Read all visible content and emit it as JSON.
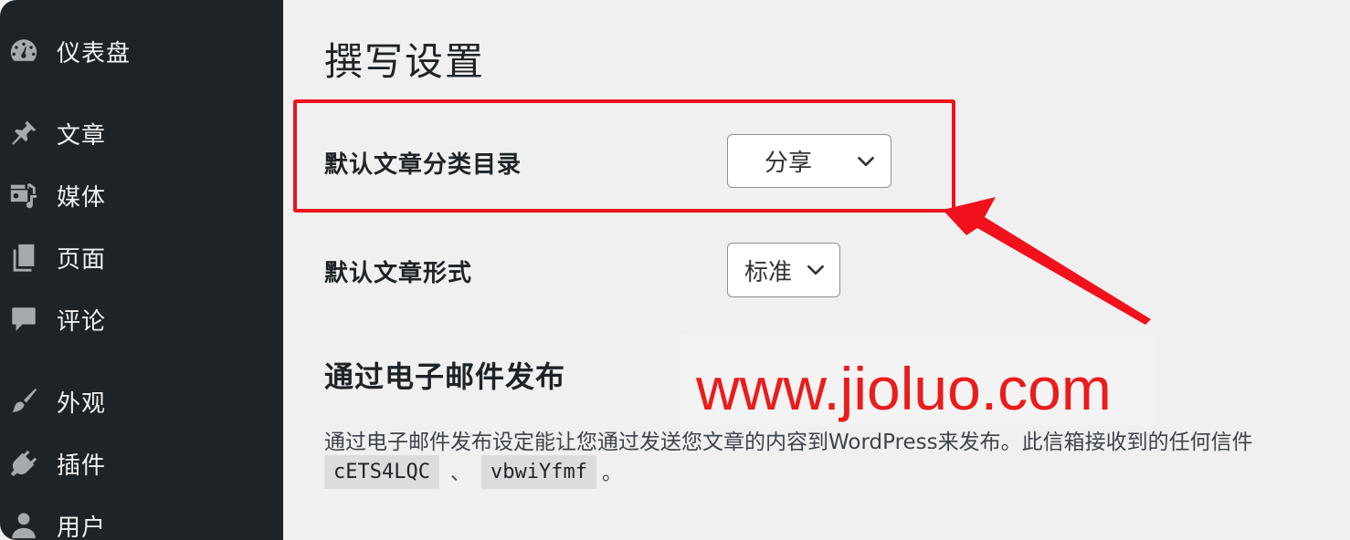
{
  "sidebar": {
    "items": [
      {
        "label": "仪表盘",
        "icon": "dashboard-icon"
      },
      {
        "label": "文章",
        "icon": "pushpin-icon"
      },
      {
        "label": "媒体",
        "icon": "media-icon"
      },
      {
        "label": "页面",
        "icon": "pages-icon"
      },
      {
        "label": "评论",
        "icon": "comment-icon"
      },
      {
        "label": "外观",
        "icon": "paintbrush-icon"
      },
      {
        "label": "插件",
        "icon": "plugin-icon"
      },
      {
        "label": "用户",
        "icon": "user-icon"
      }
    ]
  },
  "main": {
    "title": "撰写设置",
    "default_category": {
      "label": "默认文章分类目录",
      "value": "分享"
    },
    "default_format": {
      "label": "默认文章形式",
      "value": "标准"
    },
    "email_section": {
      "title": "通过电子邮件发布",
      "description": "通过电子邮件发布设定能让您通过发送您文章的内容到WordPress来发布。此信箱接收到的任何信件",
      "codes": [
        "cETS4LQC",
        "vbwiYfmf"
      ],
      "code_separator": "、",
      "end_mark": "。"
    }
  },
  "watermark": "www.jioluo.com",
  "colors": {
    "sidebar_bg": "#1d2327",
    "content_bg": "#f0f0f1",
    "annotation_red": "#f0111c"
  }
}
